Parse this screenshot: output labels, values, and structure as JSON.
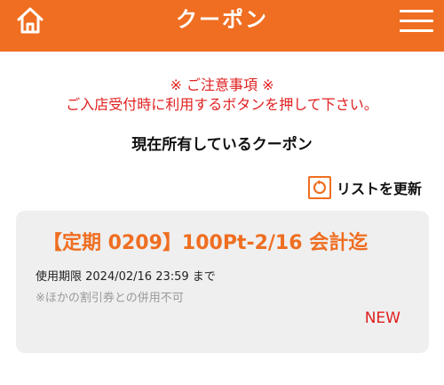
{
  "header": {
    "title": "クーポン",
    "home_icon": "home-icon",
    "menu_icon": "hamburger-menu-icon",
    "background_color": "#ef6e21"
  },
  "notice": {
    "line1": "※ ご注意事項 ※",
    "line2": "ご入店受付時に利用するボタンを押して下さい。",
    "color": "#e02020"
  },
  "section": {
    "heading": "現在所有しているクーポン"
  },
  "refresh": {
    "label": "リストを更新",
    "icon": "refresh-icon"
  },
  "coupons": [
    {
      "title": "【定期 0209】100Pt-2/16 会計迄",
      "expiry": "使用期限 2024/02/16 23:59 まで",
      "note": "※ほかの割引券との併用不可",
      "badge": "NEW"
    }
  ]
}
